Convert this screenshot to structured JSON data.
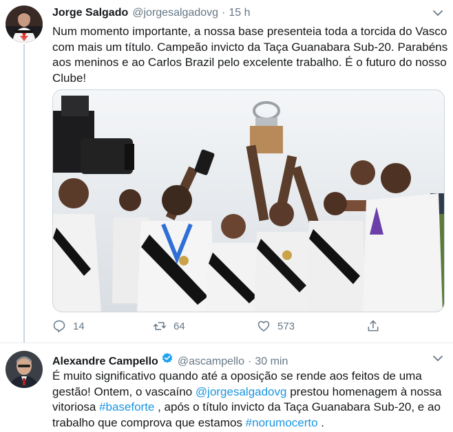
{
  "tweets": [
    {
      "author": {
        "name": "Jorge Salgado",
        "handle": "@jorgesalgadovg"
      },
      "separator": "·",
      "time": "15 h",
      "text_lines": [
        "Num momento importante, a nossa base presenteia toda a torcida do Vasco",
        "com mais um título. Campeão invicto da Taça Guanabara Sub-20. Parabéns",
        "aos meninos e ao Carlos Brazil pelo excelente trabalho. É o futuro do nosso",
        "Clube!"
      ],
      "media": {
        "alt": "Jogadores do Vasco celebrando com o troféu"
      },
      "actions": {
        "replies": "14",
        "retweets": "64",
        "likes": "573"
      },
      "icons": [
        "chevron-down-icon",
        "reply-icon",
        "retweet-icon",
        "like-icon",
        "share-icon"
      ]
    },
    {
      "author": {
        "name": "Alexandre Campello",
        "handle": "@ascampello"
      },
      "separator": "·",
      "time": "30 min",
      "text": {
        "line1": "É muito significativo quando até a oposição se rende aos feitos de uma",
        "line2": "gestão! Ontem, o vascaíno ",
        "mention": "@jorgesalgadovg",
        "line2_end": " prestou homenagem à nossa",
        "line3_start": "vitoriosa ",
        "hashtag1": "#baseforte",
        "line3_end": " , após o título invicto da Taça Guanabara Sub-20, e ao",
        "line4_start": "trabalho que comprova que estamos ",
        "hashtag2": "#norumocerto",
        "line4_end": " ."
      },
      "icons": [
        "verified-icon",
        "chevron-down-icon"
      ]
    }
  ],
  "colors": {
    "text": "#14171a",
    "muted": "#657786",
    "link": "#1b95e0",
    "border": "#ccd6dd",
    "verified": "#1da1f2"
  }
}
